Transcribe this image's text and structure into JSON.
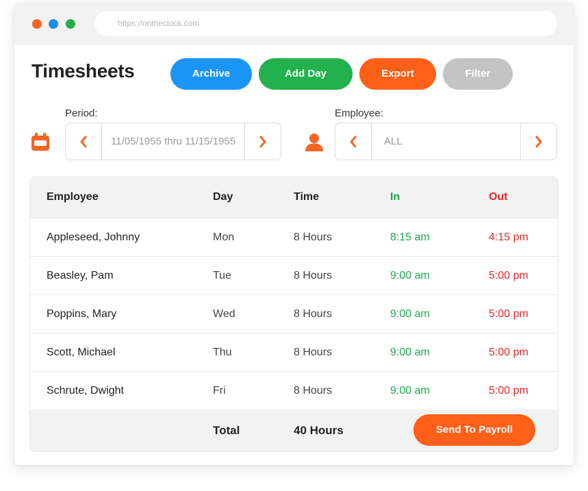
{
  "colors": {
    "window_red": "#f26522",
    "window_blue": "#1a8fe8",
    "window_green": "#22b14c",
    "archive": "#1a95f5",
    "add_day": "#22b14c",
    "export": "#fe6018",
    "filter": "#c4c4c4",
    "accent": "#f26522",
    "in_green": "#1fa84b",
    "out_red": "#e8272a"
  },
  "browser": {
    "url": "https://ontheclock.com"
  },
  "page": {
    "title": "Timesheets"
  },
  "toolbar": {
    "archive_label": "Archive",
    "add_day_label": "Add Day",
    "export_label": "Export",
    "filter_label": "Filter"
  },
  "period": {
    "label": "Period:",
    "value": "11/05/1955 thru 11/15/1955",
    "icon": "calendar-icon"
  },
  "employee_filter": {
    "label": "Employee:",
    "value": "ALL",
    "icon": "person-icon"
  },
  "table": {
    "headers": {
      "employee": "Employee",
      "day": "Day",
      "time": "Time",
      "in": "In",
      "out": "Out"
    },
    "rows": [
      {
        "employee": "Appleseed, Johnny",
        "day": "Mon",
        "time": "8 Hours",
        "in": "8:15 am",
        "out": "4:15 pm"
      },
      {
        "employee": "Beasley, Pam",
        "day": "Tue",
        "time": "8 Hours",
        "in": "9:00 am",
        "out": "5:00 pm"
      },
      {
        "employee": "Poppins, Mary",
        "day": "Wed",
        "time": "8 Hours",
        "in": "9:00 am",
        "out": "5:00 pm"
      },
      {
        "employee": "Scott, Michael",
        "day": "Thu",
        "time": "8 Hours",
        "in": "9:00 am",
        "out": "5:00 pm"
      },
      {
        "employee": "Schrute, Dwight",
        "day": "Fri",
        "time": "8 Hours",
        "in": "9:00 am",
        "out": "5:00 pm"
      }
    ],
    "footer": {
      "total_label": "Total",
      "total_value": "40 Hours",
      "payroll_label": "Send To Payroll"
    }
  }
}
